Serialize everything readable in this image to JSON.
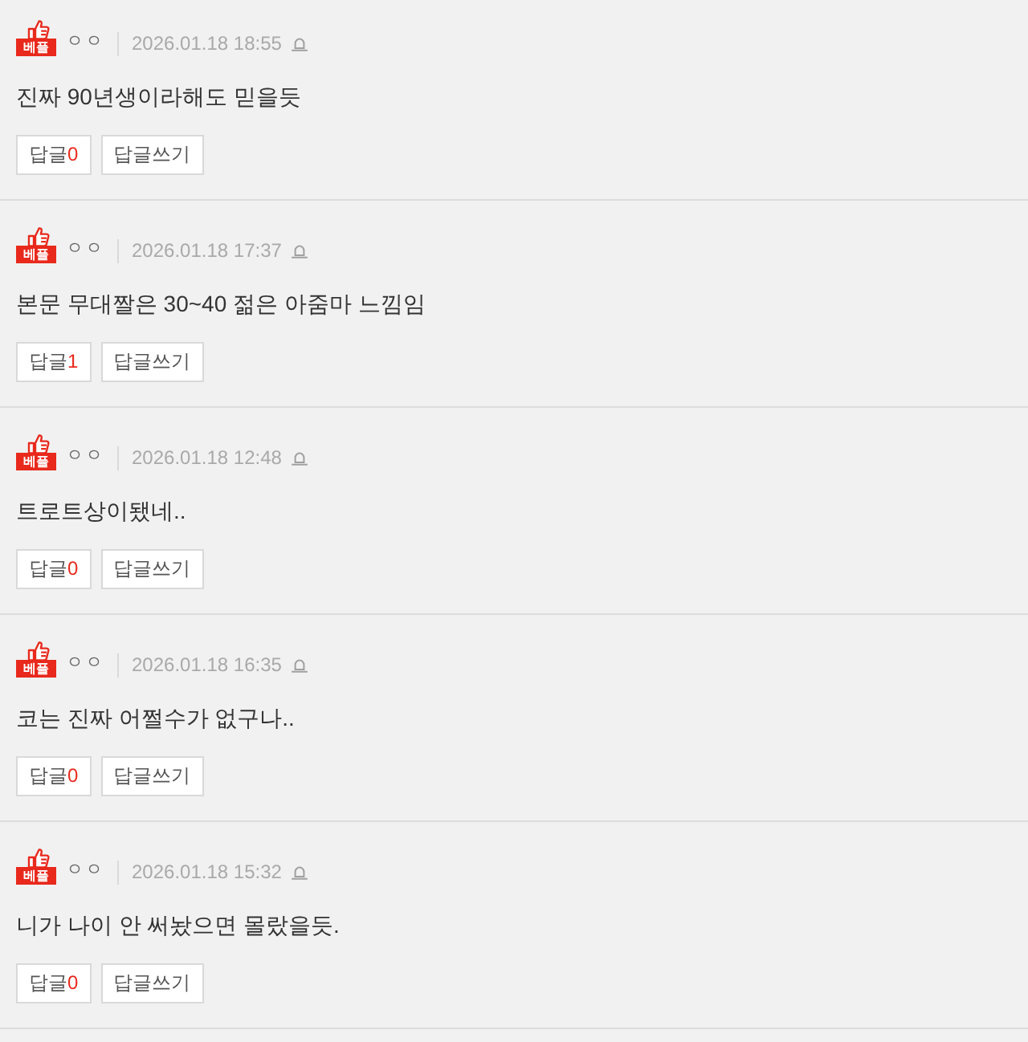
{
  "comments": [
    {
      "badge": "베플",
      "author": "ㅇㅇ",
      "date": "2026.01.18 18:55",
      "text": "진짜 90년생이라해도 믿을듯",
      "reply_label": "답글",
      "reply_count": "0",
      "write_reply": "답글쓰기"
    },
    {
      "badge": "베플",
      "author": "ㅇㅇ",
      "date": "2026.01.18 17:37",
      "text": "본문 무대짤은 30~40 젊은 아줌마 느낌임",
      "reply_label": "답글",
      "reply_count": "1",
      "write_reply": "답글쓰기"
    },
    {
      "badge": "베플",
      "author": "ㅇㅇ",
      "date": "2026.01.18 12:48",
      "text": "트로트상이됐네..",
      "reply_label": "답글",
      "reply_count": "0",
      "write_reply": "답글쓰기"
    },
    {
      "badge": "베플",
      "author": "ㅇㅇ",
      "date": "2026.01.18 16:35",
      "text": "코는 진짜 어쩔수가 없구나..",
      "reply_label": "답글",
      "reply_count": "0",
      "write_reply": "답글쓰기"
    },
    {
      "badge": "베플",
      "author": "ㅇㅇ",
      "date": "2026.01.18 15:32",
      "text": "니가 나이 안 써놨으면 몰랐을듯.",
      "reply_label": "답글",
      "reply_count": "0",
      "write_reply": "답글쓰기"
    }
  ]
}
